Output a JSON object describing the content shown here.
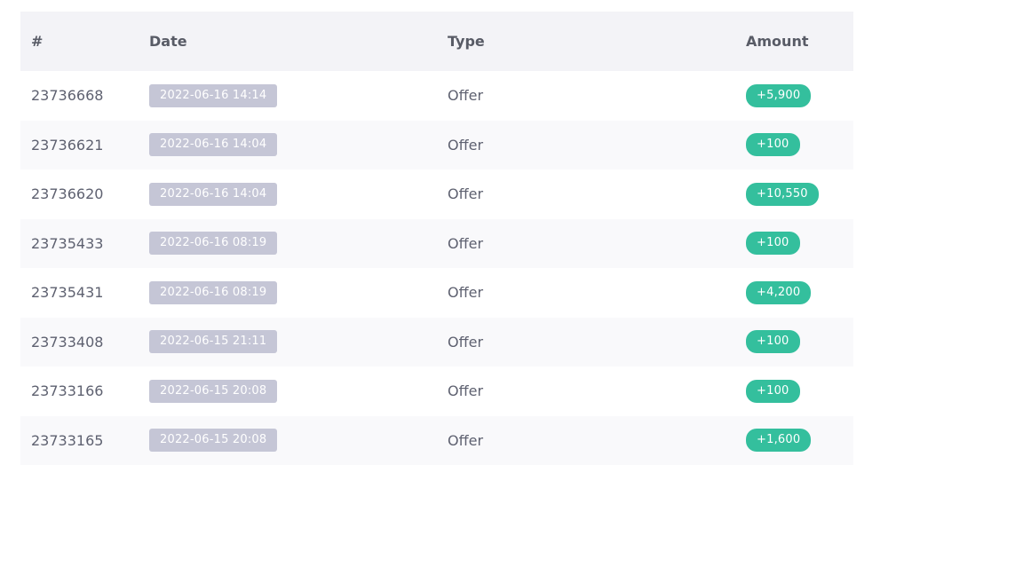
{
  "colors": {
    "header_bg": "#f3f3f7",
    "row_alt_bg": "#f9f9fb",
    "date_badge_bg": "#c5c6d6",
    "amount_badge_bg": "#34bf9d",
    "text": "#5e6170"
  },
  "table": {
    "headers": {
      "id": "#",
      "date": "Date",
      "type": "Type",
      "amount": "Amount"
    },
    "rows": [
      {
        "id": "23736668",
        "date": "2022-06-16 14:14",
        "type": "Offer",
        "amount": "+5,900"
      },
      {
        "id": "23736621",
        "date": "2022-06-16 14:04",
        "type": "Offer",
        "amount": "+100"
      },
      {
        "id": "23736620",
        "date": "2022-06-16 14:04",
        "type": "Offer",
        "amount": "+10,550"
      },
      {
        "id": "23735433",
        "date": "2022-06-16 08:19",
        "type": "Offer",
        "amount": "+100"
      },
      {
        "id": "23735431",
        "date": "2022-06-16 08:19",
        "type": "Offer",
        "amount": "+4,200"
      },
      {
        "id": "23733408",
        "date": "2022-06-15 21:11",
        "type": "Offer",
        "amount": "+100"
      },
      {
        "id": "23733166",
        "date": "2022-06-15 20:08",
        "type": "Offer",
        "amount": "+100"
      },
      {
        "id": "23733165",
        "date": "2022-06-15 20:08",
        "type": "Offer",
        "amount": "+1,600"
      }
    ]
  }
}
